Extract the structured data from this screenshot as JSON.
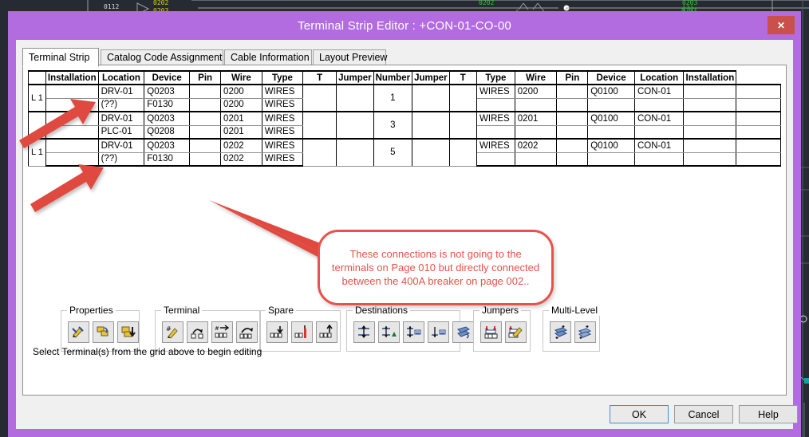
{
  "window": {
    "title": "Terminal Strip Editor : +CON-01-CO-00",
    "close_label": "✕",
    "titlebar_color": "#b26ce0",
    "close_color": "#c9504b"
  },
  "tabs": [
    {
      "label": "Terminal Strip",
      "active": true
    },
    {
      "label": "Catalog Code Assignment",
      "active": false
    },
    {
      "label": "Cable Information",
      "active": false
    },
    {
      "label": "Layout Preview",
      "active": false
    }
  ],
  "grid": {
    "headers_left": [
      "",
      "Installation",
      "Location",
      "Device",
      "Pin",
      "Wire",
      "Type"
    ],
    "headers_mid": [
      "T",
      "Jumper",
      "Number",
      "Jumper",
      "T"
    ],
    "headers_right": [
      "Type",
      "Wire",
      "Pin",
      "Device",
      "Location",
      "Installation"
    ],
    "selected_color": "#c6c6f0",
    "rows": [
      {
        "row_header": "L 1",
        "number": "1",
        "lines": [
          {
            "installation": "",
            "location": "DRV-01",
            "device": "Q0203",
            "pin": "",
            "wire": "0200",
            "type": "WIRES",
            "r_type": "WIRES",
            "r_wire": "0200",
            "r_pin": "",
            "r_device": "Q0100",
            "r_location": "CON-01",
            "r_installation": ""
          },
          {
            "installation": "",
            "location": "(??)",
            "device": "F0130",
            "pin": "",
            "wire": "0200",
            "type": "WIRES",
            "r_type": "",
            "r_wire": "",
            "r_pin": "",
            "r_device": "",
            "r_location": "",
            "r_installation": ""
          }
        ]
      },
      {
        "row_header": "",
        "number": "3",
        "lines": [
          {
            "installation": "",
            "location": "DRV-01",
            "device": "Q0203",
            "pin": "",
            "wire": "0201",
            "type": "WIRES",
            "r_type": "WIRES",
            "r_wire": "0201",
            "r_pin": "",
            "r_device": "Q0100",
            "r_location": "CON-01",
            "r_installation": ""
          },
          {
            "installation": "",
            "location": "PLC-01",
            "device": "Q0208",
            "pin": "",
            "wire": "0201",
            "type": "WIRES",
            "r_type": "",
            "r_wire": "",
            "r_pin": "",
            "r_device": "",
            "r_location": "",
            "r_installation": ""
          }
        ]
      },
      {
        "row_header": "L 1",
        "number": "5",
        "lines": [
          {
            "installation": "",
            "location": "DRV-01",
            "device": "Q0203",
            "pin": "",
            "wire": "0202",
            "type": "WIRES",
            "r_type": "WIRES",
            "r_wire": "0202",
            "r_pin": "",
            "r_device": "Q0100",
            "r_location": "CON-01",
            "r_installation": ""
          },
          {
            "installation": "",
            "location": "(??)",
            "device": "F0130",
            "pin": "",
            "wire": "0202",
            "type": "WIRES",
            "r_type": "",
            "r_wire": "",
            "r_pin": "",
            "r_device": "",
            "r_location": "",
            "r_installation": ""
          }
        ]
      }
    ]
  },
  "groups": [
    {
      "title": "Properties",
      "buttons": [
        "edit-properties-icon",
        "copy-properties-icon",
        "insert-properties-icon"
      ]
    },
    {
      "title": "Terminal",
      "buttons": [
        "edit-terminal-number-icon",
        "move-terminal-icon",
        "renumber-terminals-icon",
        "move-terminal-group-icon"
      ]
    },
    {
      "title": "Spare",
      "buttons": [
        "insert-spare-icon",
        "add-spare-icon",
        "remove-spare-icon"
      ]
    },
    {
      "title": "Destinations",
      "buttons": [
        "destination-move-icon",
        "destination-up-icon",
        "destination-edit-icon",
        "destination-add-icon",
        "destination-swap-icon"
      ]
    },
    {
      "title": "Jumpers",
      "buttons": [
        "add-jumper-icon",
        "edit-jumper-icon"
      ]
    },
    {
      "title": "Multi-Level",
      "buttons": [
        "multilevel-add-icon",
        "multilevel-edit-icon"
      ]
    }
  ],
  "status_text": "Select Terminal(s) from the grid above to begin editing",
  "buttons": {
    "ok": "OK",
    "cancel": "Cancel",
    "help": "Help"
  },
  "annotation": {
    "callout_text": "These connections is not going to the terminals on Page 010 but directly connected between the 400A breaker on page 002..",
    "color": "#e8524a",
    "arrows": 3
  },
  "background": {
    "wire_labels": [
      "0112",
      "0202",
      "0203",
      "0202",
      "0203"
    ],
    "canvas_color": "#262b33"
  }
}
